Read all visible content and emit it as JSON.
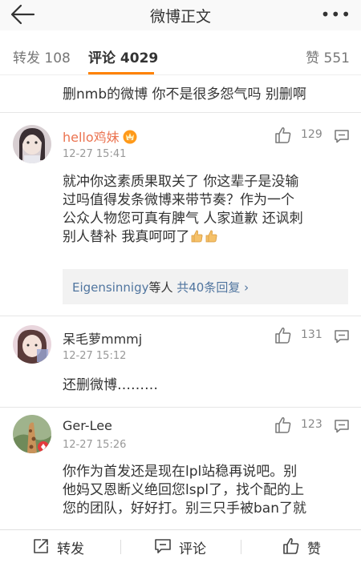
{
  "header": {
    "title": "微博正文"
  },
  "tabs": {
    "repost": "转发 108",
    "comment": "评论 4029",
    "like": "赞 551"
  },
  "trail_text": "删nmb的微博 你不是很多怨气吗 别删啊",
  "comments": [
    {
      "username": "hello鸡妹",
      "time": "12-27 15:41",
      "likes": "129",
      "lines": [
        "就冲你这素质果取关了 你这辈子是没输",
        "过吗值得发条微博来带节奏？作为一个",
        "公众人物您可真有脾气 人家道歉 还讽刺",
        "别人替补 我真呵呵了"
      ],
      "replies": {
        "name": "Eigensinnigy",
        "mid": "等人",
        "total": "共40条回复 ›"
      }
    },
    {
      "username": "呆毛萝mmmj",
      "time": "12-27 15:12",
      "likes": "131",
      "lines": [
        "还删微博………"
      ]
    },
    {
      "username": "Ger-Lee",
      "time": "12-27 15:26",
      "likes": "123",
      "lines": [
        "你作为首发还是现在lpl站稳再说吧。别",
        "他妈又恩断义绝回您lspl了，找个配的上",
        "您的团队，好好打。别三只手被ban了就"
      ]
    }
  ],
  "bottom": {
    "repost": "转发",
    "comment": "评论",
    "like": "赞"
  },
  "colors": {
    "accent": "#ff8200",
    "username_highlight": "#eb7350",
    "link": "#50759f"
  }
}
